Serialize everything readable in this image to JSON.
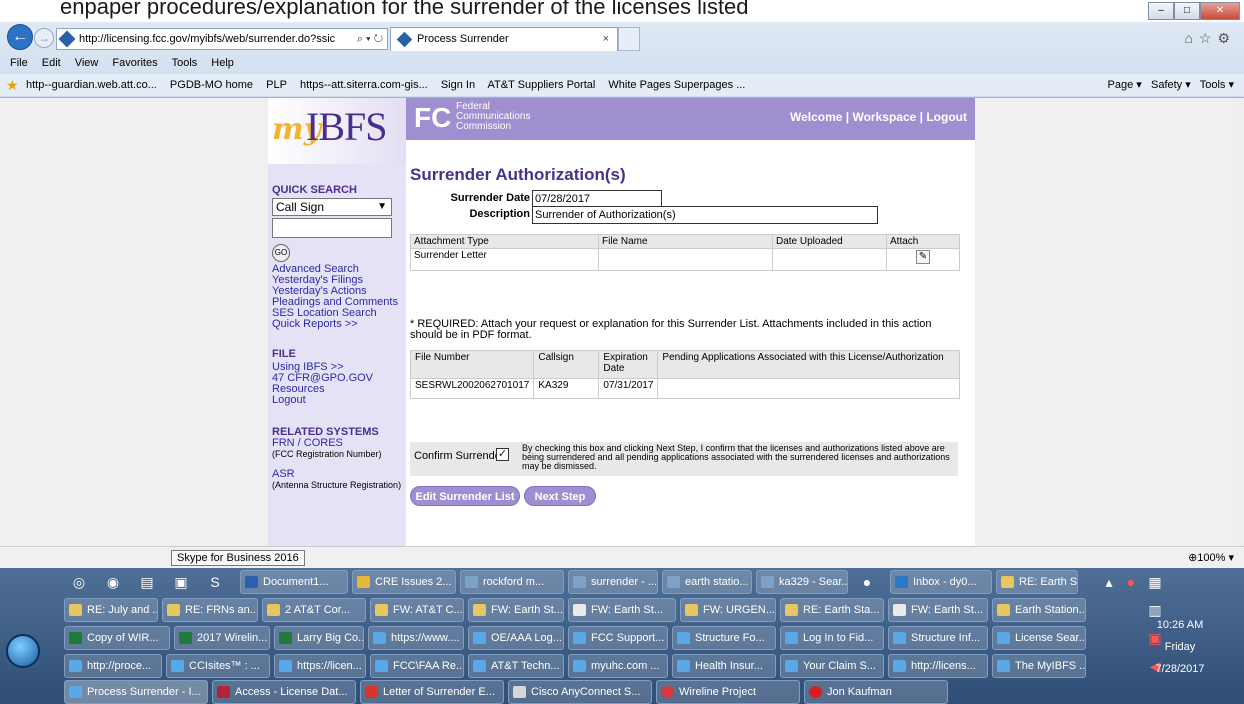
{
  "top_fragment": "enpaper procedures/explanation for the surrender of the licenses listed",
  "browser": {
    "address": "http://licensing.fcc.gov/myibfs/web/surrender.do?ssic",
    "tab_title": "Process Surrender",
    "menu": [
      "File",
      "Edit",
      "View",
      "Favorites",
      "Tools",
      "Help"
    ],
    "favorites": [
      "http--guardian.web.att.co...",
      "PGDB-MO home",
      "PLP",
      "https--att.siterra.com-gis...",
      "Sign In",
      "AT&T Suppliers Portal",
      "White Pages Superpages ..."
    ],
    "toolbar_right": [
      "Page ▾",
      "Safety ▾",
      "Tools ▾"
    ]
  },
  "header": {
    "logo_my": "my",
    "logo_ibfs": "IBFS",
    "fcc_lines": [
      "Federal",
      "Communications",
      "Commission"
    ],
    "welcome": "Welcome",
    "workspace": "Workspace",
    "logout": "Logout",
    "sep": "|"
  },
  "sidebar": {
    "quick_search": "QUICK SEARCH",
    "search_type": "Call Sign",
    "go": "GO",
    "links": [
      "Advanced Search",
      "Yesterday's Filings",
      "Yesterday's Actions",
      "Pleadings and Comments",
      "SES Location Search",
      "Quick Reports >>"
    ],
    "file": "FILE",
    "file_links": [
      "Using IBFS >>",
      "47 CFR@GPO.GOV",
      "Resources",
      "Logout"
    ],
    "related": "RELATED SYSTEMS",
    "frn": "FRN / CORES",
    "frn_note": "(FCC Registration Number)",
    "asr": "ASR",
    "asr_note": "(Antenna Structure Registration)"
  },
  "form": {
    "title": "Surrender Authorization(s)",
    "surrender_date_label": "Surrender Date",
    "surrender_date": "07/28/2017",
    "description_label": "Description",
    "description": "Surrender of Authorization(s)",
    "attach_headers": [
      "Attachment Type",
      "File Name",
      "Date Uploaded",
      "Attach"
    ],
    "attach_type": "Surrender Letter",
    "required": "* REQUIRED: Attach your request or explanation for this Surrender List. Attachments included in this action should be in PDF format.",
    "file_headers": [
      "File Number",
      "Callsign",
      "Expiration Date",
      "Pending Applications Associated with this License/Authorization"
    ],
    "file_row": [
      "SESRWL2002062701017",
      "KA329",
      "07/31/2017",
      ""
    ],
    "confirm_label": "Confirm Surrender",
    "confirm_checked": "✓",
    "confirm_text": "By checking this box and clicking Next Step, I confirm that the licenses and authorizations listed above are being surrendered and all pending applications associated with the surrendered licenses and authorizations may be dismissed.",
    "edit_button": "Edit Surrender List",
    "next_button": "Next Step"
  },
  "statusbar": {
    "tooltip": "Skype for Business 2016",
    "zoom": "100%"
  },
  "taskbar": {
    "row1": [
      "Document1...",
      "CRE Issues 2...",
      "rockford m...",
      "surrender - ...",
      "earth statio...",
      "ka329 - Sear...",
      "Inbox - dy0...",
      "RE: Earth St..."
    ],
    "row2": [
      "RE: July and ...",
      "RE: FRNs an...",
      "2 AT&T Cor...",
      "FW: AT&T C...",
      "FW: Earth St...",
      "FW: Earth St...",
      "FW: URGEN...",
      "RE: Earth Sta...",
      "FW: Earth St...",
      "Earth Station..."
    ],
    "row3": [
      "Copy of WIR...",
      "2017 Wirelin...",
      "Larry Big Co...",
      "https://www....",
      "OE/AAA Log...",
      "FCC Support...",
      "Structure Fo...",
      "Log In to Fid...",
      "Structure Inf...",
      "License Sear..."
    ],
    "row4": [
      "http://proce...",
      "CCIsites™ : ...",
      "https://licen...",
      "FCC\\FAA Re...",
      "AT&T Techn...",
      "myuhc.com ...",
      "Health Insur...",
      "Your Claim S...",
      "http://licens...",
      "The MyIBFS ..."
    ],
    "row5": [
      "Process Surrender - I...",
      "Access - License Dat...",
      "Letter of Surrender E...",
      "Cisco AnyConnect S...",
      "Wireline Project",
      "Jon Kaufman"
    ],
    "time": "10:26 AM",
    "day": "Friday",
    "date": "7/28/2017"
  }
}
